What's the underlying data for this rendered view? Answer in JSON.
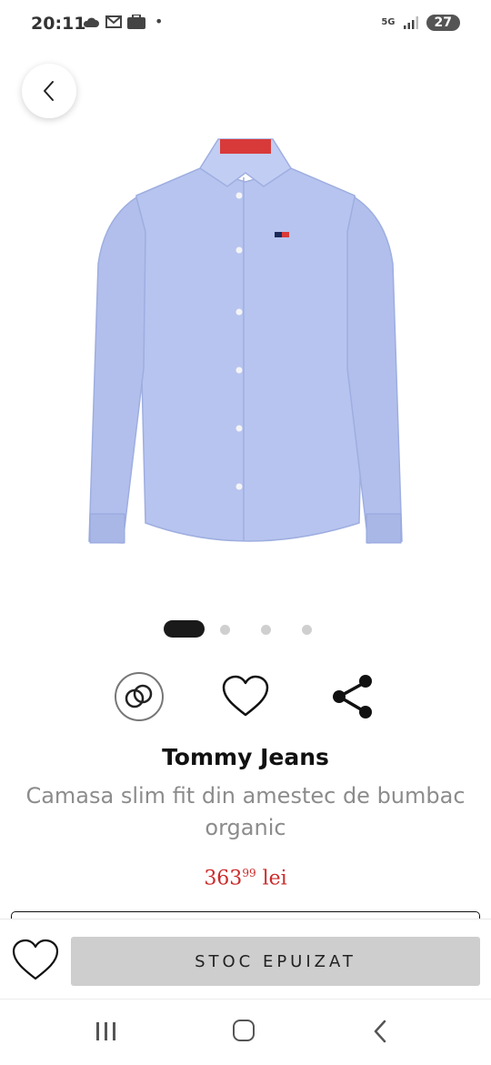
{
  "status_bar": {
    "time": "20:11",
    "icons_left": [
      "cloud-icon",
      "mail-icon",
      "emag-icon"
    ],
    "network_type": "5G",
    "battery": "27"
  },
  "product": {
    "brand": "Tommy Jeans",
    "title": "Camasa slim fit din amestec de bumbac organic",
    "price_main": "363",
    "price_decimals": "99",
    "currency": "lei",
    "image_colors": {
      "shirt": "#b4c1ee",
      "label": "#d83a3a"
    }
  },
  "carousel": {
    "count": 4,
    "active_index": 0
  },
  "actions": [
    "compare-icon",
    "heart-icon",
    "share-icon"
  ],
  "bottom_bar": {
    "stock_label": "STOC EPUIZAT"
  },
  "colors": {
    "accent_price": "#cc2b2b",
    "button_disabled": "#cecece"
  }
}
